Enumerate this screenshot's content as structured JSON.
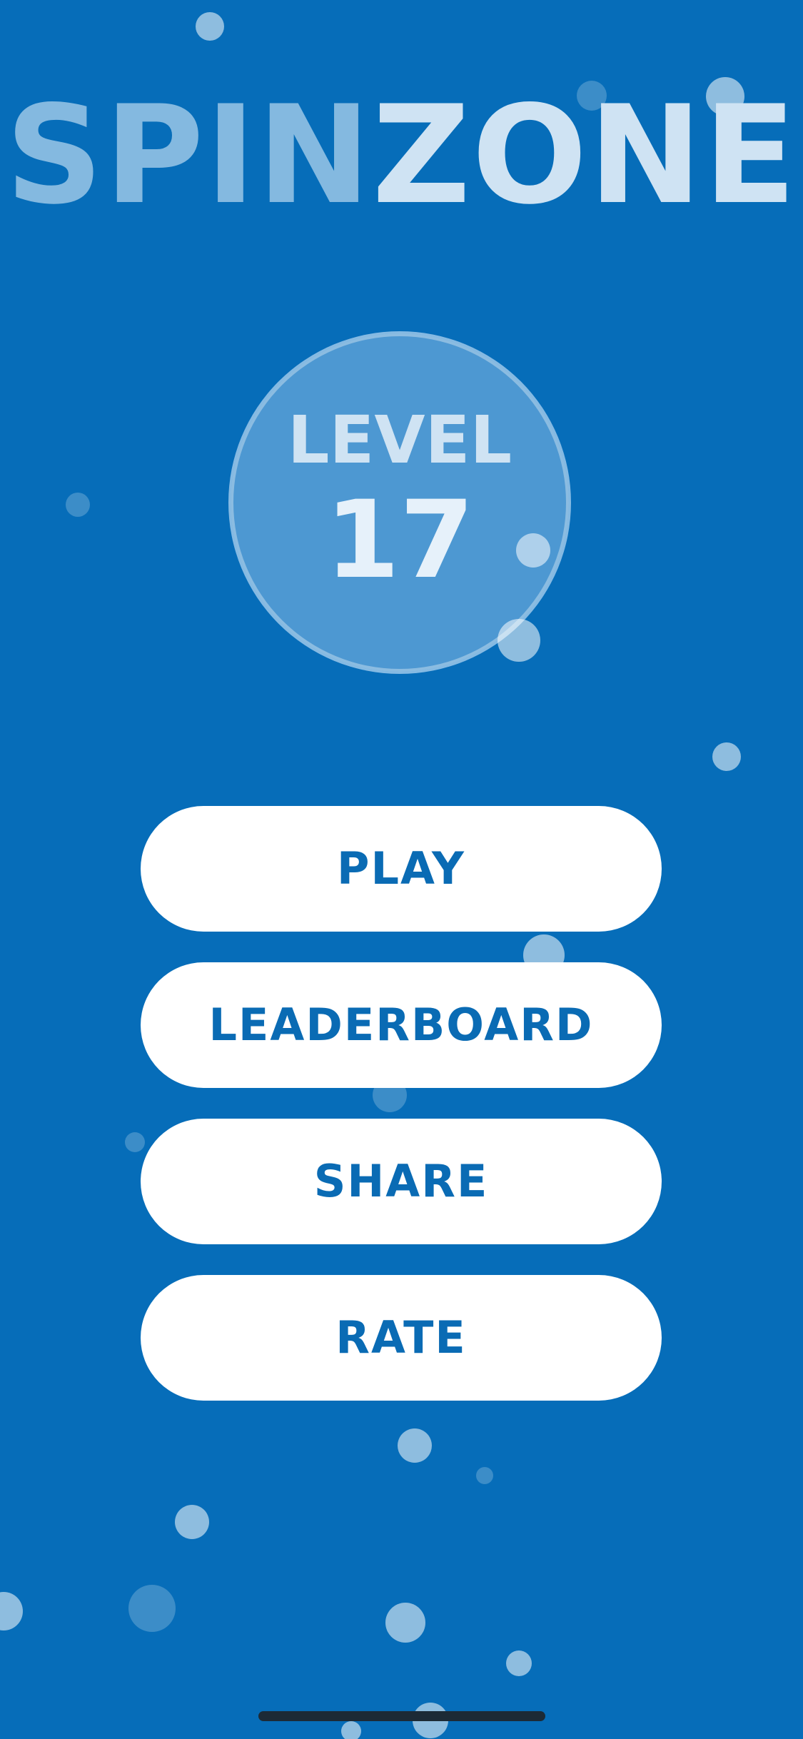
{
  "title": {
    "part1": "SPIN",
    "part2": "ZONE"
  },
  "level": {
    "label": "LEVEL",
    "number": "17"
  },
  "menu": {
    "play": "PLAY",
    "leaderboard": "LEADERBOARD",
    "share": "SHARE",
    "rate": "RATE"
  },
  "colors": {
    "background": "#066db9",
    "button": "#ffffff",
    "button_text": "#0a6bb4",
    "title_spin": "#84b9e0",
    "title_zone": "#cfe3f3",
    "level_circle": "#4d98d2"
  }
}
